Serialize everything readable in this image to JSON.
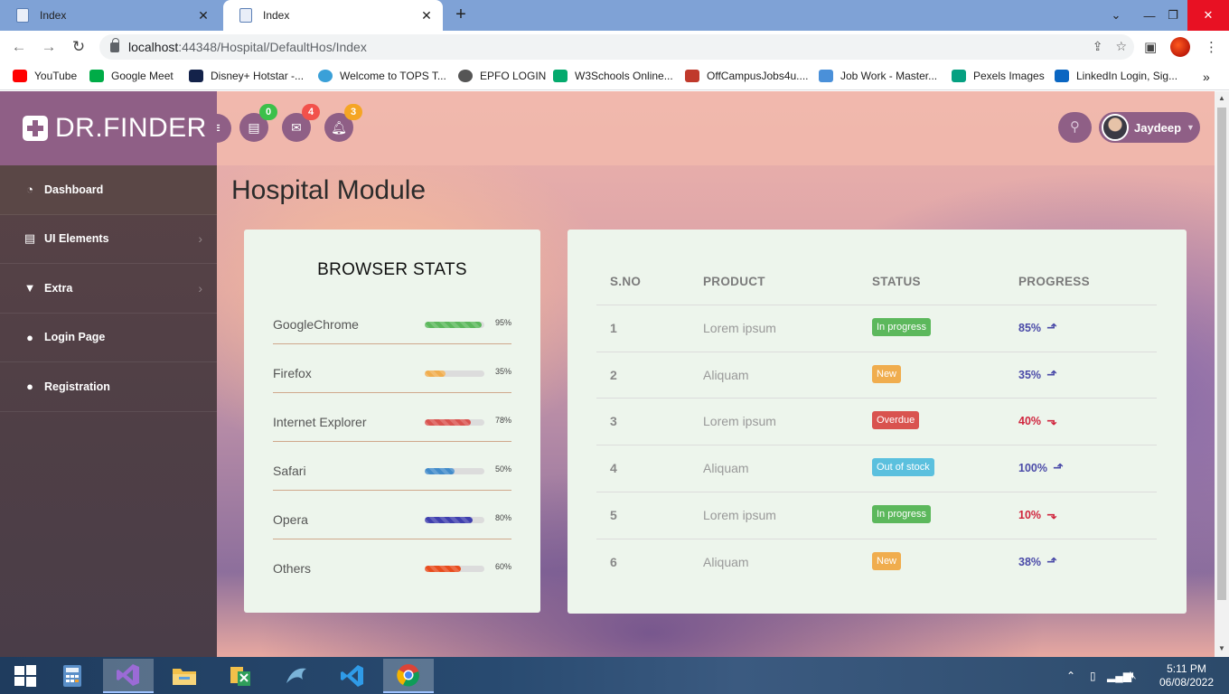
{
  "browser": {
    "tabs": [
      {
        "title": "Index",
        "active": false
      },
      {
        "title": "Index",
        "active": true
      }
    ],
    "url_host": "localhost",
    "url_rest": ":44348/Hospital/DefaultHos/Index",
    "bookmarks": [
      {
        "label": "YouTube",
        "icon": "youtube-icon",
        "color": "#ff0000"
      },
      {
        "label": "Google Meet",
        "icon": "google-meet-icon",
        "color": "#00ac47"
      },
      {
        "label": "Disney+ Hotstar -...",
        "icon": "hotstar-icon",
        "color": "#13224a"
      },
      {
        "label": "Welcome to TOPS T...",
        "icon": "tops-icon",
        "color": "#3aa0d8"
      },
      {
        "label": "EPFO LOGIN",
        "icon": "globe-icon",
        "color": "#555555"
      },
      {
        "label": "W3Schools Online...",
        "icon": "w3schools-icon",
        "color": "#04aa6d"
      },
      {
        "label": "OffCampusJobs4u....",
        "icon": "offcampus-icon",
        "color": "#c0392b"
      },
      {
        "label": "Job Work - Master...",
        "icon": "masters-icon",
        "color": "#4a90d9"
      },
      {
        "label": "Pexels Images",
        "icon": "pexels-icon",
        "color": "#05a081"
      },
      {
        "label": "LinkedIn Login, Sig...",
        "icon": "linkedin-icon",
        "color": "#0a66c2"
      }
    ]
  },
  "app": {
    "brand": "DR.FINDER",
    "page_title": "Hospital Module",
    "user_name": "Jaydeep",
    "notifications": [
      {
        "icon": "list-icon",
        "count": "0",
        "color": "#3cc04a"
      },
      {
        "icon": "mail-icon",
        "count": "4",
        "color": "#f2514b"
      },
      {
        "icon": "bell-icon",
        "count": "3",
        "color": "#f5a524"
      }
    ],
    "menu": [
      {
        "label": "Dashboard",
        "icon": "dashboard-icon",
        "glyph": "◔",
        "chevron": false,
        "active": true
      },
      {
        "label": "UI Elements",
        "icon": "book-icon",
        "glyph": "▤",
        "chevron": true,
        "active": false
      },
      {
        "label": "Extra",
        "icon": "filter-icon",
        "glyph": "▼",
        "chevron": true,
        "active": false
      },
      {
        "label": "Login Page",
        "icon": "user-icon",
        "glyph": "●",
        "chevron": false,
        "active": false
      },
      {
        "label": "Registration",
        "icon": "user-plus-icon",
        "glyph": "●",
        "chevron": false,
        "active": false
      }
    ]
  },
  "stats": {
    "title": "BROWSER STATS",
    "rows": [
      {
        "name": "GoogleChrome",
        "value": 95,
        "label": "95%",
        "color": "#5cb85c"
      },
      {
        "name": "Firefox",
        "value": 35,
        "label": "35%",
        "color": "#f0ad4e"
      },
      {
        "name": "Internet Explorer",
        "value": 78,
        "label": "78%",
        "color": "#d9534f"
      },
      {
        "name": "Safari",
        "value": 50,
        "label": "50%",
        "color": "#428bca"
      },
      {
        "name": "Opera",
        "value": 80,
        "label": "80%",
        "color": "#3f3fae"
      },
      {
        "name": "Others",
        "value": 60,
        "label": "60%",
        "color": "#e84c1d"
      }
    ]
  },
  "table": {
    "headers": [
      "S.NO",
      "PRODUCT",
      "STATUS",
      "PROGRESS"
    ],
    "rows": [
      {
        "sno": "1",
        "product": "Lorem ipsum",
        "status": "In progress",
        "status_color": "#5cb85c",
        "progress": "85%",
        "trend": "up"
      },
      {
        "sno": "2",
        "product": "Aliquam",
        "status": "New",
        "status_color": "#f0ad4e",
        "progress": "35%",
        "trend": "up"
      },
      {
        "sno": "3",
        "product": "Lorem ipsum",
        "status": "Overdue",
        "status_color": "#d9534f",
        "progress": "40%",
        "trend": "down"
      },
      {
        "sno": "4",
        "product": "Aliquam",
        "status": "Out of stock",
        "status_color": "#5bc0de",
        "progress": "100%",
        "trend": "up"
      },
      {
        "sno": "5",
        "product": "Lorem ipsum",
        "status": "In progress",
        "status_color": "#5cb85c",
        "progress": "10%",
        "trend": "down"
      },
      {
        "sno": "6",
        "product": "Aliquam",
        "status": "New",
        "status_color": "#f0ad4e",
        "progress": "38%",
        "trend": "up"
      }
    ],
    "up_color": "#4a4aa8",
    "down_color": "#d0243d"
  },
  "taskbar": {
    "time": "5:11 PM",
    "date": "06/08/2022"
  }
}
